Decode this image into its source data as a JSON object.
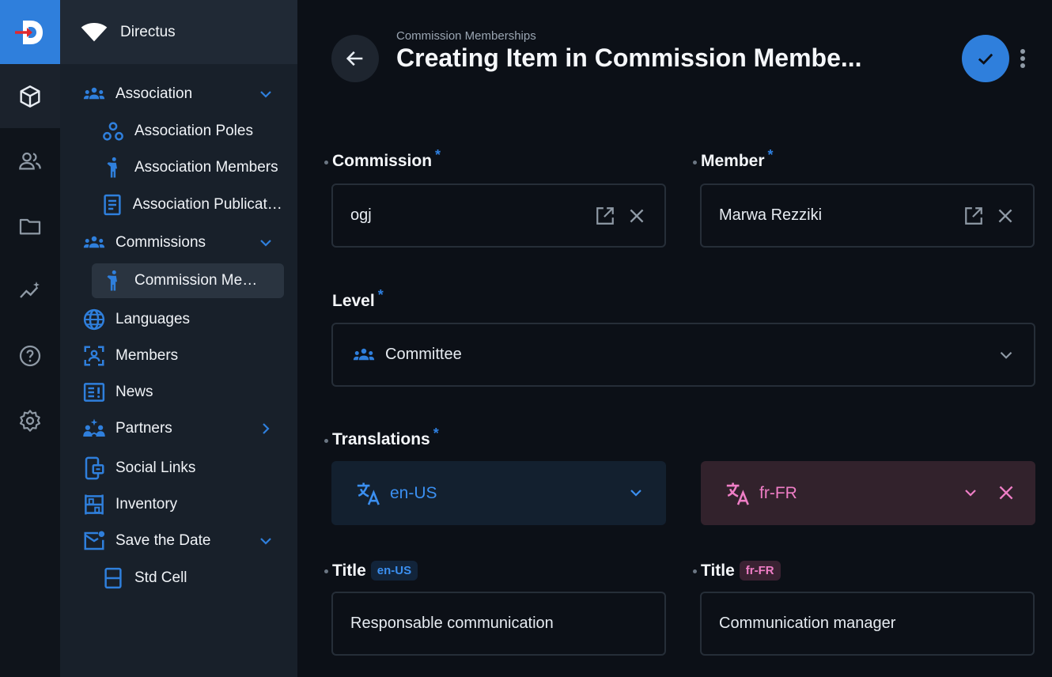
{
  "app": {
    "project_name": "Directus"
  },
  "modules": [
    "content-module",
    "users-module",
    "files-module",
    "insights-module",
    "help-module",
    "settings-module"
  ],
  "nav": {
    "items": [
      {
        "label": "Association",
        "icon": "groups-icon",
        "expandable": "down"
      },
      {
        "label": "Association Poles",
        "icon": "workspaces-icon",
        "sub": true
      },
      {
        "label": "Association Members",
        "icon": "person-icon",
        "sub": true
      },
      {
        "label": "Association Publications",
        "icon": "article-icon",
        "sub": true
      },
      {
        "label": "Commissions",
        "icon": "groups-icon",
        "expandable": "down"
      },
      {
        "label": "Commission Memberships",
        "icon": "person-icon",
        "sub": true,
        "active": true
      },
      {
        "label": "Languages",
        "icon": "globe-icon"
      },
      {
        "label": "Members",
        "icon": "face-frame-icon"
      },
      {
        "label": "News",
        "icon": "news-icon"
      },
      {
        "label": "Partners",
        "icon": "partners-icon",
        "expandable": "right"
      },
      {
        "label": "Social Links",
        "icon": "phone-link-icon"
      },
      {
        "label": "Inventory",
        "icon": "shelves-icon"
      },
      {
        "label": "Save the Date",
        "icon": "mail-unread-icon",
        "expandable": "down"
      },
      {
        "label": "Std Cell",
        "icon": "table-rows-icon",
        "sub": true
      }
    ]
  },
  "header": {
    "breadcrumb": "Commission Memberships",
    "title": "Creating Item in Commission Membe..."
  },
  "form": {
    "commission": {
      "label": "Commission",
      "required": "*",
      "value": "ogj"
    },
    "member": {
      "label": "Member",
      "required": "*",
      "value": "Marwa Rezziki"
    },
    "level": {
      "label": "Level",
      "required": "*",
      "value": "Committee"
    },
    "translations": {
      "label": "Translations",
      "required": "*",
      "primary_lang": "en-US",
      "secondary_lang": "fr-FR"
    },
    "title_en": {
      "label": "Title",
      "lang": "en-US",
      "value": "Responsable communication"
    },
    "title_fr": {
      "label": "Title",
      "lang": "fr-FR",
      "value": "Communication manager"
    }
  },
  "colors": {
    "accent": "#2f7fdc",
    "secondary": "#ef7ec6",
    "background": "#0c1017"
  }
}
